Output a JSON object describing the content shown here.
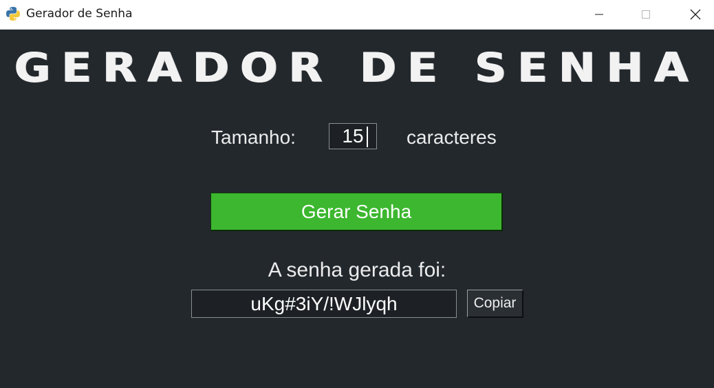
{
  "window": {
    "title": "Gerador de Senha",
    "icon": "python-icon"
  },
  "titlebar_buttons": [
    "minimize-icon",
    "maximize-icon",
    "close-icon"
  ],
  "main": {
    "heading": "GERADOR DE SENHA",
    "size_label": "Tamanho:",
    "size_value": "15",
    "size_unit": "caracteres",
    "generate_button": "Gerar Senha",
    "result_label": "A senha gerada foi:",
    "password": "uKg#3iY/!WJlyqh",
    "copy_button": "Copiar"
  },
  "colors": {
    "background": "#23282d",
    "generate_button": "#3cb72f",
    "text": "#ececec"
  }
}
